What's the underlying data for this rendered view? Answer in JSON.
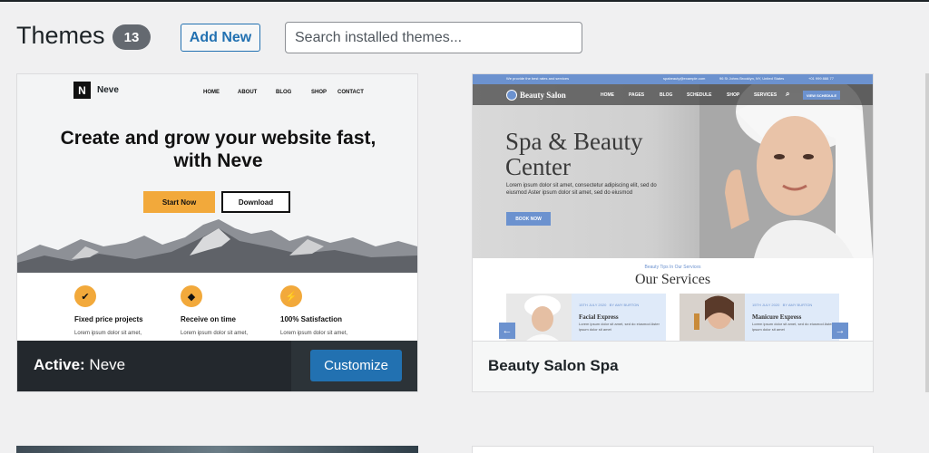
{
  "header": {
    "title": "Themes",
    "count": "13",
    "add_new_label": "Add New",
    "search_placeholder": "Search installed themes..."
  },
  "themes": [
    {
      "name": "Neve",
      "active": true,
      "footer_prefix": "Active:",
      "footer_name": "Neve",
      "customize_label": "Customize",
      "preview": {
        "logo_letter": "N",
        "brand": "Neve",
        "nav": [
          "HOME",
          "ABOUT",
          "BLOG",
          "SHOP",
          "CONTACT"
        ],
        "headline": "Create and grow your website fast, with Neve",
        "primary_button": "Start Now",
        "secondary_button": "Download",
        "features": [
          {
            "icon": "check-icon",
            "title": "Fixed price projects",
            "text": "Lorem ipsum dolor sit amet,"
          },
          {
            "icon": "diamond-icon",
            "title": "Receive on time",
            "text": "Lorem ipsum dolor sit amet,"
          },
          {
            "icon": "bolt-icon",
            "title": "100% Satisfaction",
            "text": "Lorem ipsum dolor sit amet,"
          }
        ],
        "accent_color": "#f2a93b"
      }
    },
    {
      "name": "Beauty Salon Spa",
      "active": false,
      "footer_name": "Beauty Salon Spa",
      "preview": {
        "topbar_left": "We provide the best rates and services",
        "topbar_email": "spabeauty@example.com",
        "topbar_address": "96 St Johns Brooklyn, NY, United States",
        "topbar_phone": "+01 999 888 77",
        "brand": "Beauty Salon",
        "nav": [
          "HOME",
          "PAGES",
          "BLOG",
          "SCHEDULE",
          "SHOP",
          "SERVICES"
        ],
        "nav_button": "VIEW SCHEDULE",
        "headline_line1": "Spa & Beauty",
        "headline_line2": "Center",
        "paragraph": "Lorem ipsum dolor sit amet, consectetur adipiscing elit, sed do eiusmod Aster ipsum dolor sit amet, sed do eiusmod",
        "book_button": "BOOK NOW",
        "services_sub": "Beauty Tips In Our Services",
        "services_title": "Our Services",
        "services": [
          {
            "date": "15TH JULY 2020",
            "author": "BY AMY BURTON",
            "title": "Facial Express",
            "text": "Lorem ipsum dolor sit amet, sed do eiusmod Aster ipsum dolor sit amet"
          },
          {
            "date": "15TH JULY 2020",
            "author": "BY AMY BURTON",
            "title": "Manicure Express",
            "text": "Lorem ipsum dolor sit amet, sed do eiusmod Aster ipsum dolor sit amet"
          }
        ],
        "accent_color": "#6c92cf"
      }
    }
  ]
}
